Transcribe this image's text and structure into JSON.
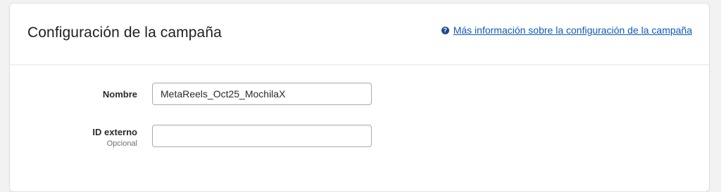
{
  "header": {
    "title": "Configuración de la campaña",
    "help_link": {
      "icon": "question-circle-icon",
      "label": "Más información sobre la configuración de la campaña"
    }
  },
  "form": {
    "name_field": {
      "label": "Nombre",
      "value": "MetaReels_Oct25_MochilaX"
    },
    "external_id_field": {
      "label": "ID externo",
      "sublabel": "Opcional",
      "value": ""
    }
  },
  "colors": {
    "link": "#1058b8",
    "help_icon_bg": "#1a4a8f",
    "input_border": "#a9a9a9"
  }
}
